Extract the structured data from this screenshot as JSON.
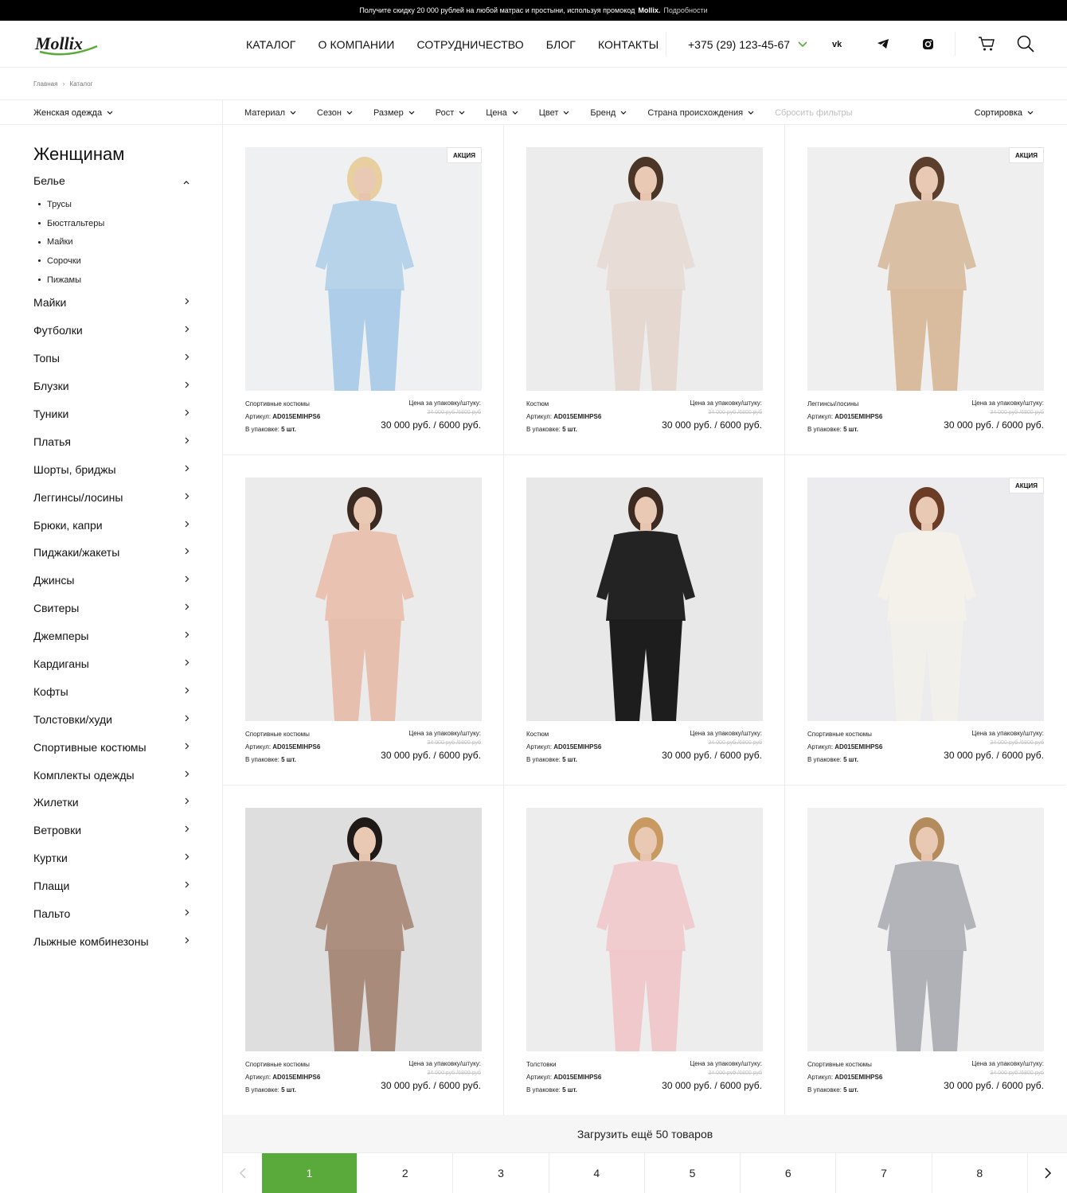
{
  "promo": {
    "text": "Получите скидку 20 000 рублей на любой матрас и простыни, используя промокод",
    "code": "Mollix.",
    "more": "Подробности"
  },
  "header": {
    "logo": "Mollix",
    "nav": [
      "КАТАЛОГ",
      "О КОМПАНИИ",
      "СОТРУДНИЧЕСТВО",
      "БЛОГ",
      "КОНТАКТЫ"
    ],
    "phone": "+375 (29) 123-45-67",
    "icons": [
      "vk-icon",
      "telegram-icon",
      "instagram-icon",
      "cart-icon",
      "search-icon"
    ]
  },
  "breadcrumbs": [
    "Главная",
    "Каталог"
  ],
  "filterbar": {
    "category": "Женская одежда",
    "filters": [
      "Материал",
      "Сезон",
      "Размер",
      "Рост",
      "Цена",
      "Цвет",
      "Бренд",
      "Страна происхождения"
    ],
    "reset": "Сбросить фильтры",
    "sort": "Сортировка"
  },
  "sidebar": {
    "title": "Женщинам",
    "open_category": "Белье",
    "subitems": [
      "Трусы",
      "Бюстгальтеры",
      "Майки",
      "Сорочки",
      "Пижамы"
    ],
    "categories": [
      "Майки",
      "Футболки",
      "Топы",
      "Блузки",
      "Туники",
      "Платья",
      "Шорты, бриджы",
      "Леггинсы/лосины",
      "Брюки, капри",
      "Пиджаки/жакеты",
      "Джинсы",
      "Свитеры",
      "Джемперы",
      "Кардиганы",
      "Кофты",
      "Толстовки/худи",
      "Спортивные костюмы",
      "Комплекты одежды",
      "Жилетки",
      "Ветровки",
      "Куртки",
      "Плащи",
      "Пальто",
      "Лыжные комбинезоны"
    ]
  },
  "product_labels": {
    "price_label": "Цена за упаковку/штуку:",
    "article_label": "Артикул:",
    "pack_label": "В упаковке:",
    "badge": "АКЦИЯ"
  },
  "products": [
    {
      "category": "Спортивные костюмы",
      "article": "AD015EMIHPS6",
      "pack": "5 шт.",
      "old_price": "34 000 руб /6800 руб",
      "price": "30 000 руб. / 6000 руб.",
      "badge": true,
      "colors": {
        "bg": "#eef0f2",
        "top": "#b7d3ea",
        "bottom": "#aecde8",
        "hair": "#e8cfa0"
      }
    },
    {
      "category": "Костюм",
      "article": "AD015EMIHPS6",
      "pack": "5 шт.",
      "old_price": "34 000 руб /6800 руб",
      "price": "30 000 руб. / 6000 руб.",
      "badge": false,
      "colors": {
        "bg": "#ececec",
        "top": "#e8dcd6",
        "bottom": "#e5d8d1",
        "hair": "#4a3526"
      }
    },
    {
      "category": "Леггинсы/лосины",
      "article": "AD015EMIHPS6",
      "pack": "5 шт.",
      "old_price": "34 000 руб /6800 руб",
      "price": "30 000 руб. / 6000 руб.",
      "badge": true,
      "colors": {
        "bg": "#efefef",
        "top": "#d9c0a4",
        "bottom": "#d8bc9d",
        "hair": "#5b3f2c"
      }
    },
    {
      "category": "Спортивные костюмы",
      "article": "AD015EMIHPS6",
      "pack": "5 шт.",
      "old_price": "34 000 руб /6800 руб",
      "price": "30 000 руб. / 6000 руб.",
      "badge": false,
      "colors": {
        "bg": "#ebebeb",
        "top": "#e9c2b2",
        "bottom": "#e6bfae",
        "hair": "#3b2a22"
      }
    },
    {
      "category": "Костюм",
      "article": "AD015EMIHPS6",
      "pack": "5 шт.",
      "old_price": "34 000 руб /6800 руб",
      "price": "30 000 руб. / 6000 руб.",
      "badge": false,
      "colors": {
        "bg": "#e8e8e8",
        "top": "#232323",
        "bottom": "#1d1d1d",
        "hair": "#3d2b22"
      }
    },
    {
      "category": "Спортивные костюмы",
      "article": "AD015EMIHPS6",
      "pack": "5 шт.",
      "old_price": "34 000 руб /6800 руб",
      "price": "30 000 руб. / 6000 руб.",
      "badge": true,
      "colors": {
        "bg": "#ececee",
        "top": "#f3f1ea",
        "bottom": "#f2f0ea",
        "hair": "#6b3c26"
      }
    },
    {
      "category": "Спортивные костюмы",
      "article": "AD015EMIHPS6",
      "pack": "5 шт.",
      "old_price": "34 000 руб /6800 руб",
      "price": "30 000 руб. / 6000 руб.",
      "badge": false,
      "colors": {
        "bg": "#dedede",
        "top": "#ad8f7f",
        "bottom": "#a98b7b",
        "hair": "#1f1a18"
      }
    },
    {
      "category": "Толстовки",
      "article": "AD015EMIHPS6",
      "pack": "5 шт.",
      "old_price": "34 000 руб /6800 руб",
      "price": "30 000 руб. / 6000 руб.",
      "badge": false,
      "colors": {
        "bg": "#ededed",
        "top": "#f1cccf",
        "bottom": "#efc9cc",
        "hair": "#c89a62"
      }
    },
    {
      "category": "Спортивные костюмы",
      "article": "AD015EMIHPS6",
      "pack": "5 шт.",
      "old_price": "34 000 руб /6800 руб",
      "price": "30 000 руб. / 6000 руб.",
      "badge": false,
      "colors": {
        "bg": "#f0f0f0",
        "top": "#b3b4b9",
        "bottom": "#b0b1b6",
        "hair": "#b48b5c"
      }
    }
  ],
  "load_more": "Загрузить ещё 50 товаров",
  "pagination": {
    "pages": [
      "1",
      "2",
      "3",
      "4",
      "5",
      "6",
      "7",
      "8"
    ],
    "current": "1"
  },
  "colors": {
    "accent": "#5aaa3b",
    "promo_bg": "#000000",
    "text": "#111111"
  }
}
